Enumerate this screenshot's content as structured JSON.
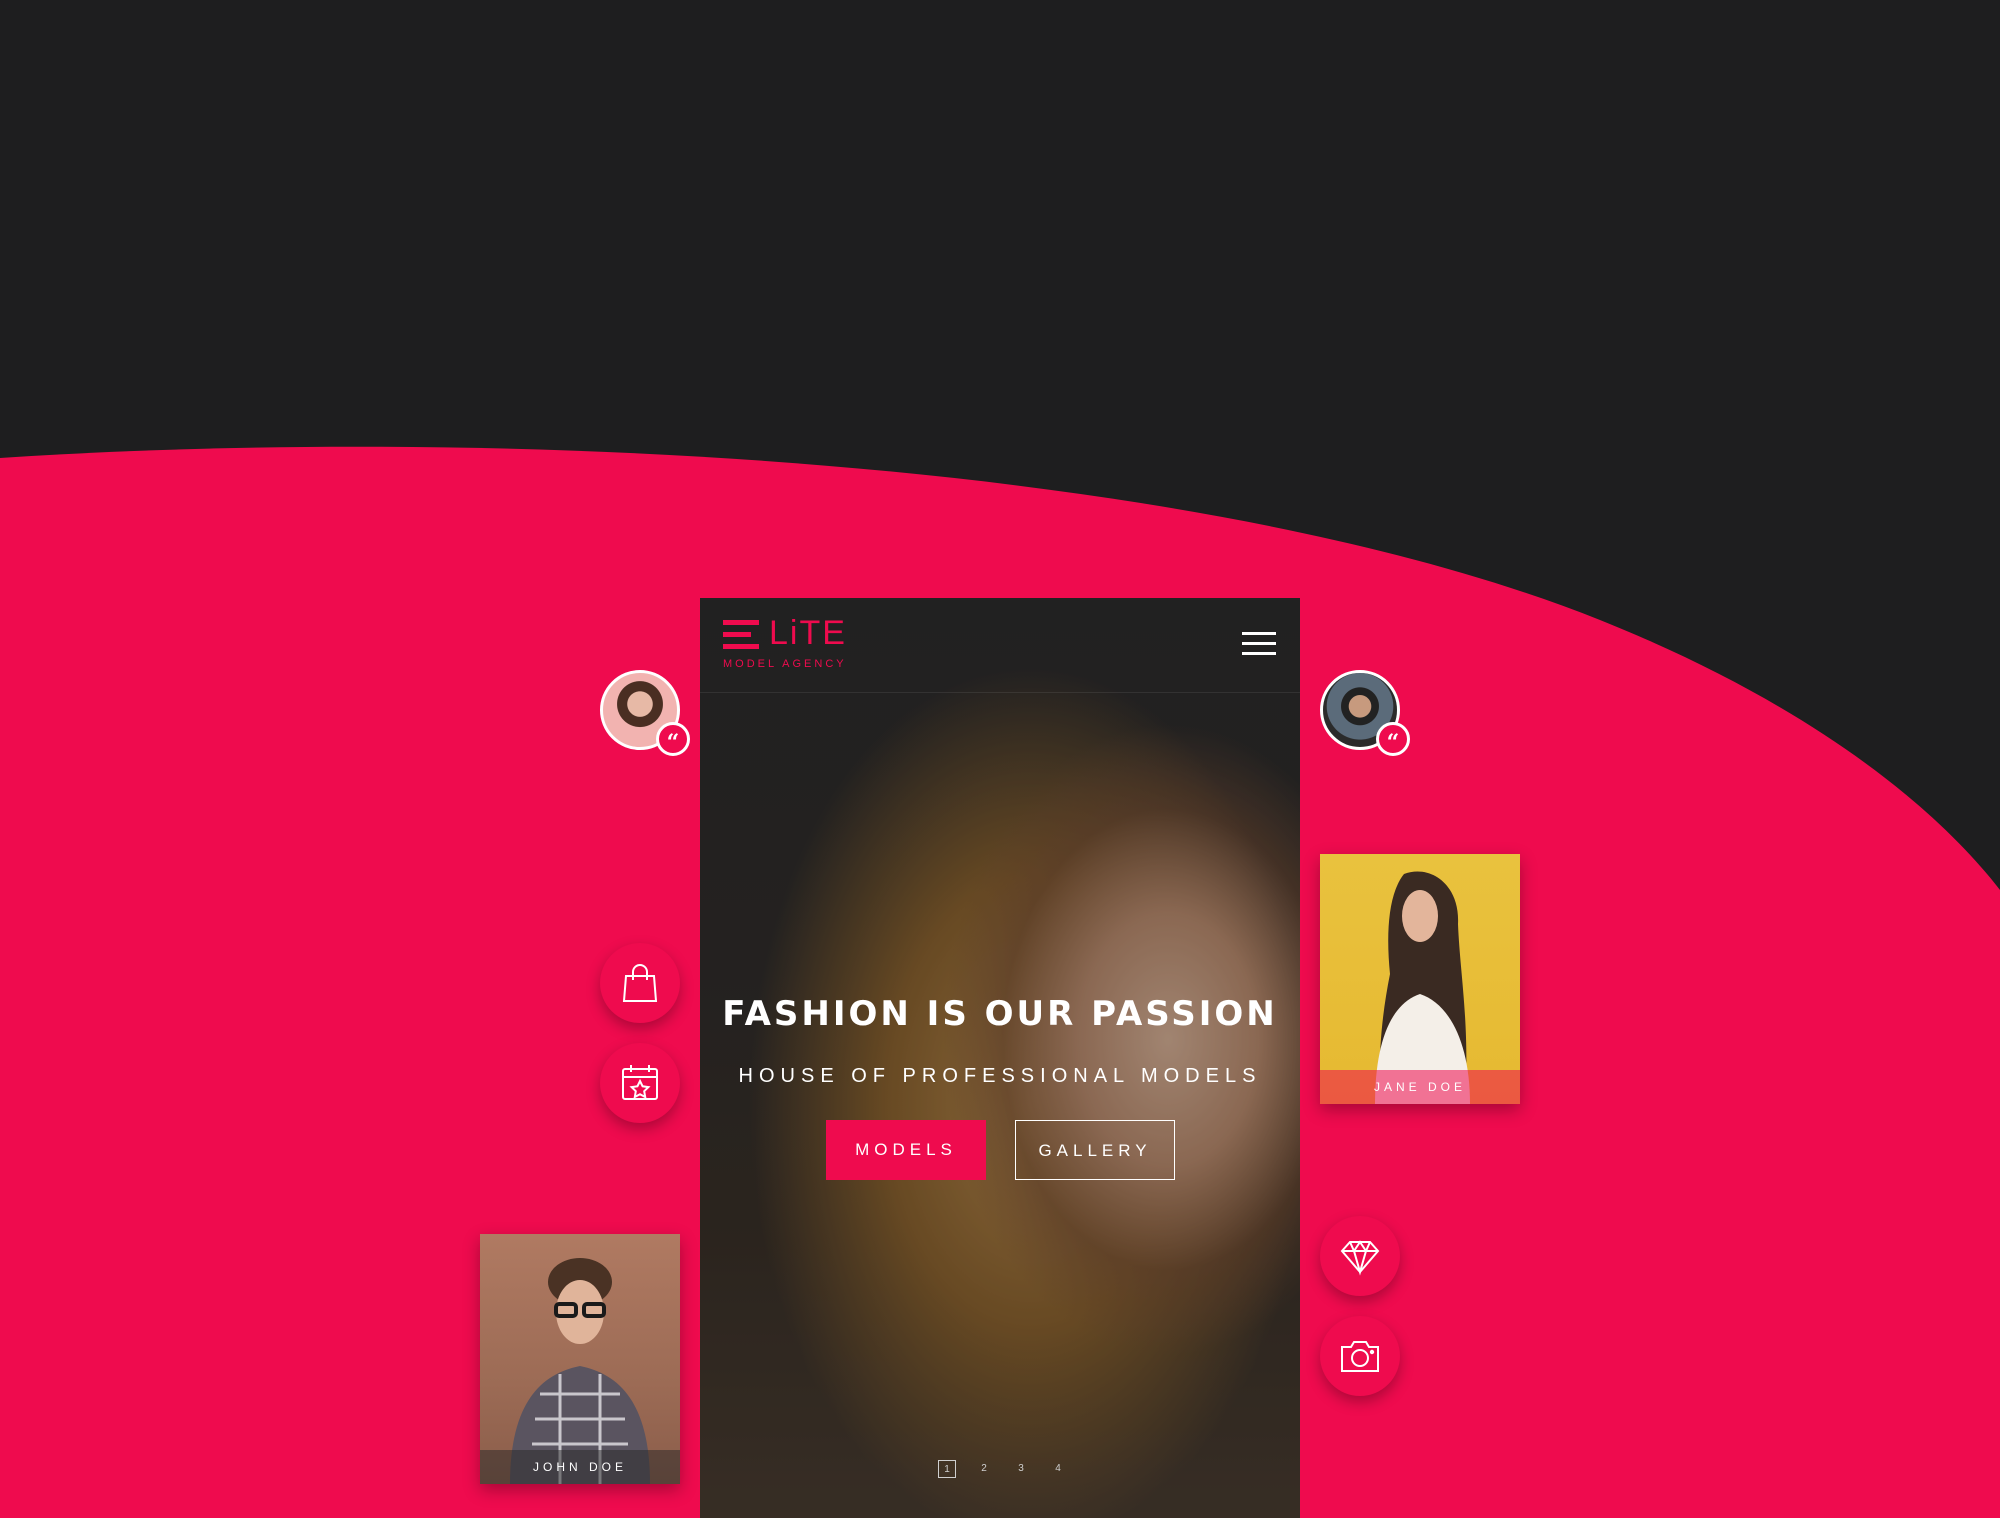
{
  "colors": {
    "accent": "#ef0b4e",
    "dark_background": "#1e1e1f",
    "white": "#ffffff"
  },
  "brand": {
    "logo_word": "LiTE",
    "tagline": "MODEL AGENCY"
  },
  "hero": {
    "title": "FASHION IS OUR PASSION",
    "subtitle": "HOUSE OF PROFESSIONAL MODELS",
    "primary_button": "MODELS",
    "secondary_button": "GALLERY"
  },
  "pager": {
    "pages": [
      "1",
      "2",
      "3",
      "4"
    ],
    "active": "1"
  },
  "testimonials": {
    "quote_glyph": "“"
  },
  "model_cards": [
    {
      "name": "JANE DOE"
    },
    {
      "name": "JOHN DOE"
    }
  ],
  "icons": {
    "left": [
      "shopping-bag-icon",
      "calendar-star-icon"
    ],
    "right": [
      "diamond-icon",
      "camera-icon"
    ],
    "header": [
      "menu-icon"
    ]
  }
}
